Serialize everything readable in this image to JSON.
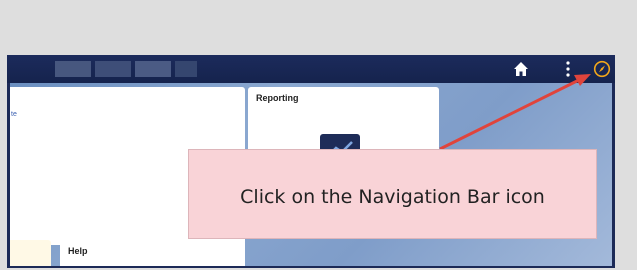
{
  "app": {
    "topbar": {
      "home_icon": "home-icon",
      "more_icon": "more-vertical-icon",
      "nav_icon": "navigation-compass-icon"
    },
    "tiles": {
      "main": {
        "link_text": "te"
      },
      "reporting": {
        "title": "Reporting",
        "icon": "chart-icon"
      },
      "help": {
        "title": "Help"
      }
    }
  },
  "callout": {
    "text": "Click on the Navigation Bar icon"
  },
  "colors": {
    "header": "#1c2a57",
    "callout_bg": "#f9d3d7",
    "arrow": "#e0443c",
    "nav_icon": "#f2a71b"
  }
}
